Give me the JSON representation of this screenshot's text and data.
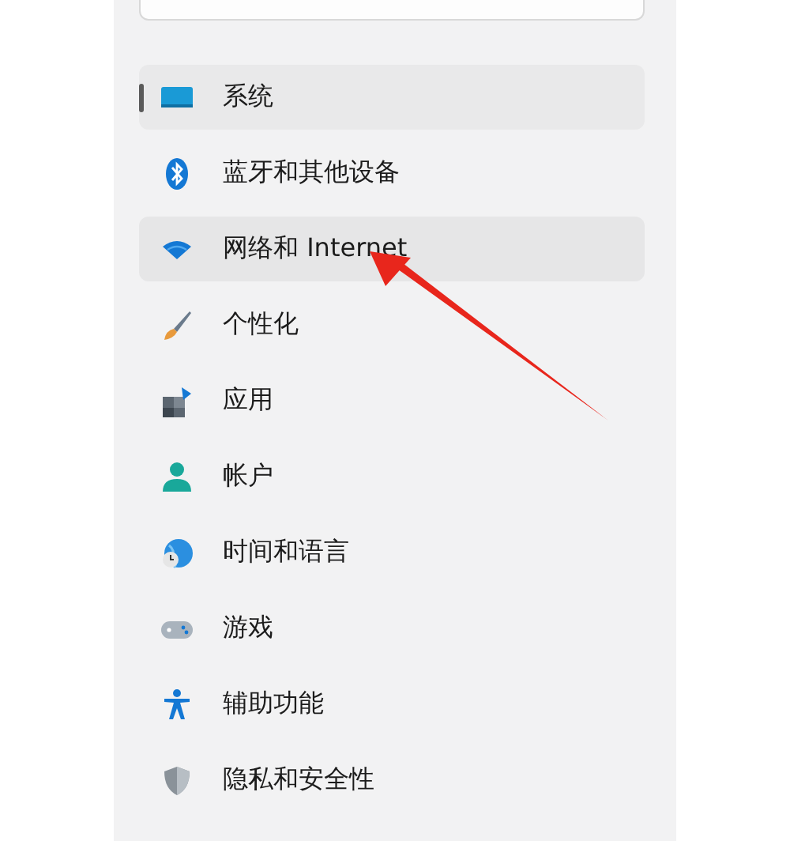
{
  "search": {
    "kind": "field"
  },
  "nav_items": [
    {
      "label": "系统",
      "selected": true,
      "hovered": false
    },
    {
      "label": "蓝牙和其他设备",
      "selected": false,
      "hovered": false
    },
    {
      "label": "网络和 Internet",
      "selected": false,
      "hovered": true
    },
    {
      "label": "个性化",
      "selected": false,
      "hovered": false
    },
    {
      "label": "应用",
      "selected": false,
      "hovered": false
    },
    {
      "label": "帐户",
      "selected": false,
      "hovered": false
    },
    {
      "label": "时间和语言",
      "selected": false,
      "hovered": false
    },
    {
      "label": "游戏",
      "selected": false,
      "hovered": false
    },
    {
      "label": "辅助功能",
      "selected": false,
      "hovered": false
    },
    {
      "label": "隐私和安全性",
      "selected": false,
      "hovered": false
    }
  ]
}
